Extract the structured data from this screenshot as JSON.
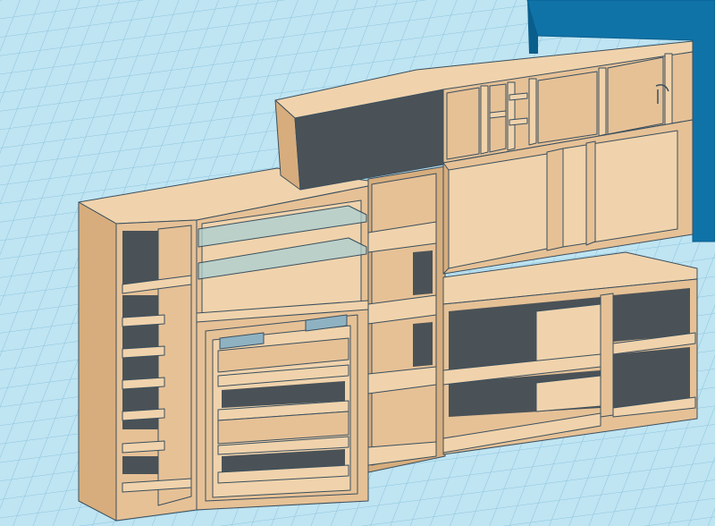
{
  "workplane": {
    "grid_color": "#6fb3d3",
    "background": "#bfe4f2"
  },
  "colors": {
    "wood": "#e6c196",
    "wood_light": "#f0d3ac",
    "wood_dark": "#d7ad7d",
    "cavity": "#4a5257",
    "edge": "#3b4f5e",
    "glass": "#a9cfd3",
    "hardware": "#8fb2c2",
    "blue_block": "#0f73a8",
    "blue_block_dark": "#0a5e8c"
  },
  "objects": [
    {
      "id": "upper-cabinet",
      "icon": "cabinet-icon"
    },
    {
      "id": "left-tall-bookcase",
      "icon": "bookcase-icon"
    },
    {
      "id": "center-glass-shelf-unit",
      "icon": "shelf-icon"
    },
    {
      "id": "narrow-open-shelf",
      "icon": "shelf-icon"
    },
    {
      "id": "right-upper-cube-unit",
      "icon": "cube-icon"
    },
    {
      "id": "right-low-sideboard",
      "icon": "sideboard-icon"
    },
    {
      "id": "blue-box",
      "icon": "box-icon"
    }
  ]
}
